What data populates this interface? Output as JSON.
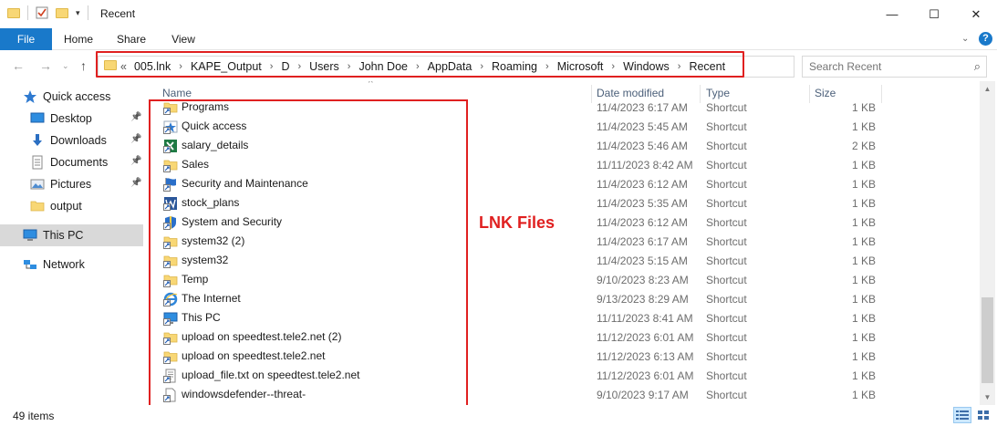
{
  "window": {
    "title": "Recent",
    "minimize": "—",
    "maximize": "☐",
    "close": "✕"
  },
  "ribbon": {
    "tabs": [
      "File",
      "Home",
      "Share",
      "View"
    ],
    "help": "?"
  },
  "address": {
    "prefix": "«",
    "crumbs": [
      "005.lnk",
      "KAPE_Output",
      "D",
      "Users",
      "John Doe",
      "AppData",
      "Roaming",
      "Microsoft",
      "Windows",
      "Recent"
    ]
  },
  "search": {
    "placeholder": "Search Recent"
  },
  "nav": [
    {
      "label": "Quick access",
      "icon": "star-icon"
    },
    {
      "label": "Desktop",
      "icon": "desktop-icon",
      "pinned": true
    },
    {
      "label": "Downloads",
      "icon": "downloads-icon",
      "pinned": true
    },
    {
      "label": "Documents",
      "icon": "documents-icon",
      "pinned": true
    },
    {
      "label": "Pictures",
      "icon": "pictures-icon",
      "pinned": true
    },
    {
      "label": "output",
      "icon": "folder-icon"
    },
    {
      "label": "This PC",
      "icon": "computer-icon",
      "selected": true
    },
    {
      "label": "Network",
      "icon": "network-icon"
    }
  ],
  "columns": {
    "name": "Name",
    "date": "Date modified",
    "type": "Type",
    "size": "Size"
  },
  "files": [
    {
      "name": "Programs",
      "date": "11/4/2023 6:17 AM",
      "type": "Shortcut",
      "size": "1 KB",
      "icon": "folder"
    },
    {
      "name": "Quick access",
      "date": "11/4/2023 5:45 AM",
      "type": "Shortcut",
      "size": "1 KB",
      "icon": "star"
    },
    {
      "name": "salary_details",
      "date": "11/4/2023 5:46 AM",
      "type": "Shortcut",
      "size": "2 KB",
      "icon": "excel"
    },
    {
      "name": "Sales",
      "date": "11/11/2023 8:42 AM",
      "type": "Shortcut",
      "size": "1 KB",
      "icon": "folder"
    },
    {
      "name": "Security and Maintenance",
      "date": "11/4/2023 6:12 AM",
      "type": "Shortcut",
      "size": "1 KB",
      "icon": "flag"
    },
    {
      "name": "stock_plans",
      "date": "11/4/2023 5:35 AM",
      "type": "Shortcut",
      "size": "1 KB",
      "icon": "word"
    },
    {
      "name": "System and Security",
      "date": "11/4/2023 6:12 AM",
      "type": "Shortcut",
      "size": "1 KB",
      "icon": "shield"
    },
    {
      "name": "system32 (2)",
      "date": "11/4/2023 6:17 AM",
      "type": "Shortcut",
      "size": "1 KB",
      "icon": "folder"
    },
    {
      "name": "system32",
      "date": "11/4/2023 5:15 AM",
      "type": "Shortcut",
      "size": "1 KB",
      "icon": "folder"
    },
    {
      "name": "Temp",
      "date": "9/10/2023 8:23 AM",
      "type": "Shortcut",
      "size": "1 KB",
      "icon": "folder"
    },
    {
      "name": "The Internet",
      "date": "9/13/2023 8:29 AM",
      "type": "Shortcut",
      "size": "1 KB",
      "icon": "ie"
    },
    {
      "name": "This PC",
      "date": "11/11/2023 8:41 AM",
      "type": "Shortcut",
      "size": "1 KB",
      "icon": "computer"
    },
    {
      "name": "upload on speedtest.tele2.net (2)",
      "date": "11/12/2023 6:01 AM",
      "type": "Shortcut",
      "size": "1 KB",
      "icon": "folder"
    },
    {
      "name": "upload on speedtest.tele2.net",
      "date": "11/12/2023 6:13 AM",
      "type": "Shortcut",
      "size": "1 KB",
      "icon": "folder"
    },
    {
      "name": "upload_file.txt on speedtest.tele2.net",
      "date": "11/12/2023 6:01 AM",
      "type": "Shortcut",
      "size": "1 KB",
      "icon": "text"
    },
    {
      "name": "windowsdefender--threat-",
      "date": "9/10/2023 9:17 AM",
      "type": "Shortcut",
      "size": "1 KB",
      "icon": "blank"
    }
  ],
  "annotation": {
    "label": "LNK Files",
    "color": "#e02020"
  },
  "status": {
    "count": "49 items"
  },
  "colors": {
    "accent": "#1979ca",
    "highlight": "#e02020"
  }
}
